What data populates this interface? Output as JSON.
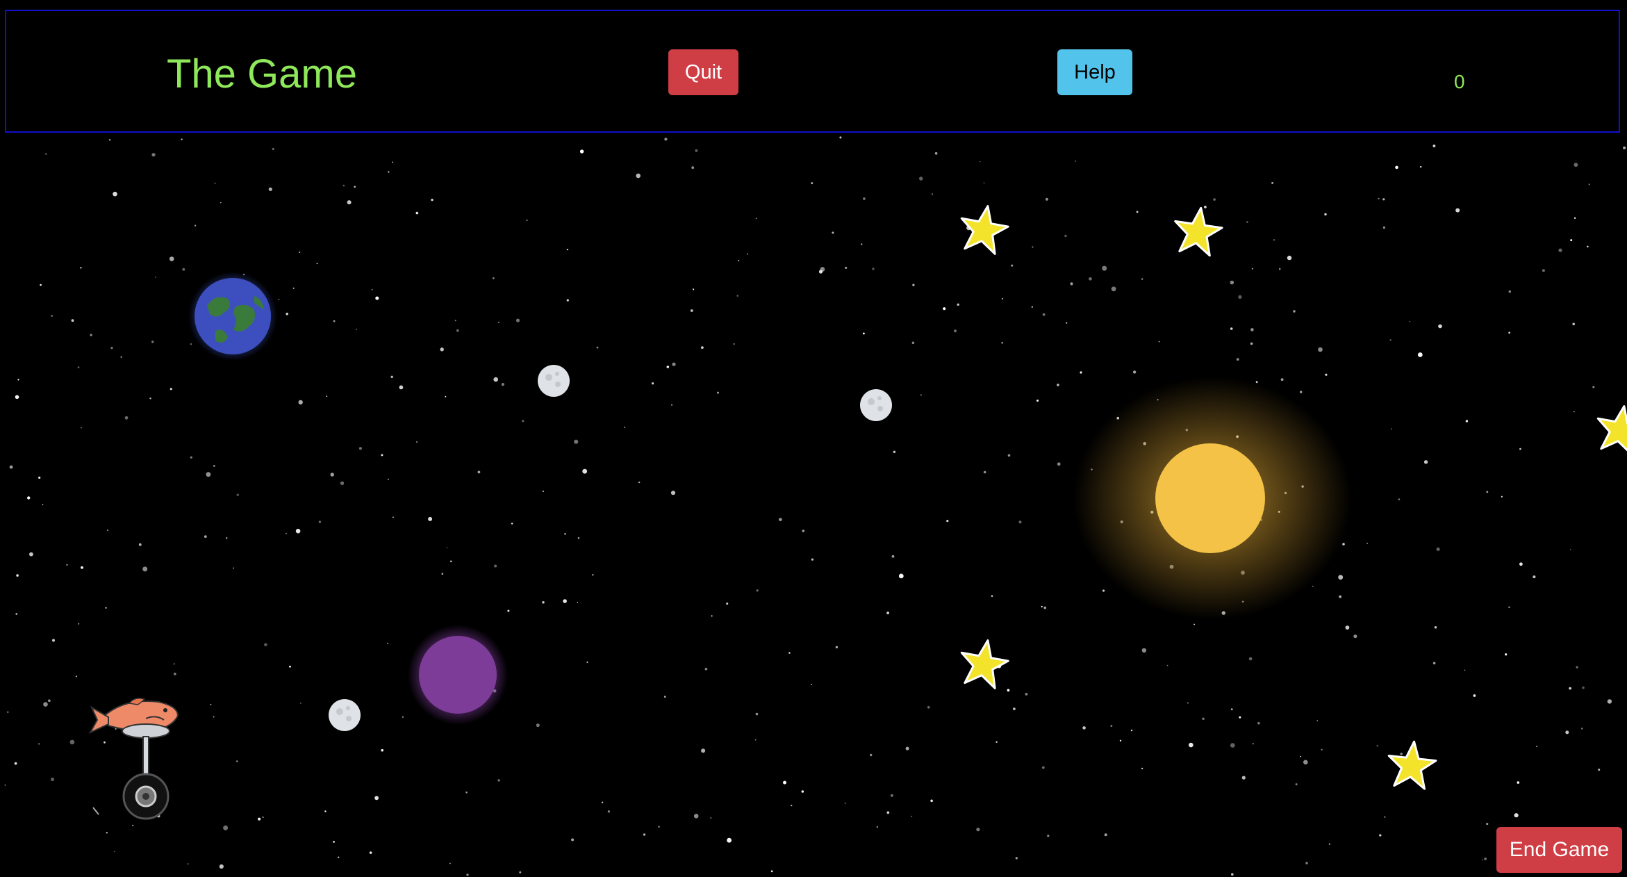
{
  "header": {
    "title": "The Game",
    "quit_label": "Quit",
    "help_label": "Help",
    "score": "0"
  },
  "footer": {
    "end_game_label": "End Game"
  },
  "colors": {
    "title_green": "#8ee85a",
    "quit_red": "#cf3e44",
    "help_blue": "#52c3ea",
    "header_border": "#1010d0",
    "background": "#000000"
  },
  "scene": {
    "sprites": [
      "earth",
      "moon",
      "moon",
      "moon",
      "purple-planet",
      "sun",
      "star",
      "star",
      "star",
      "star",
      "star",
      "player-fish-unicycle"
    ]
  }
}
